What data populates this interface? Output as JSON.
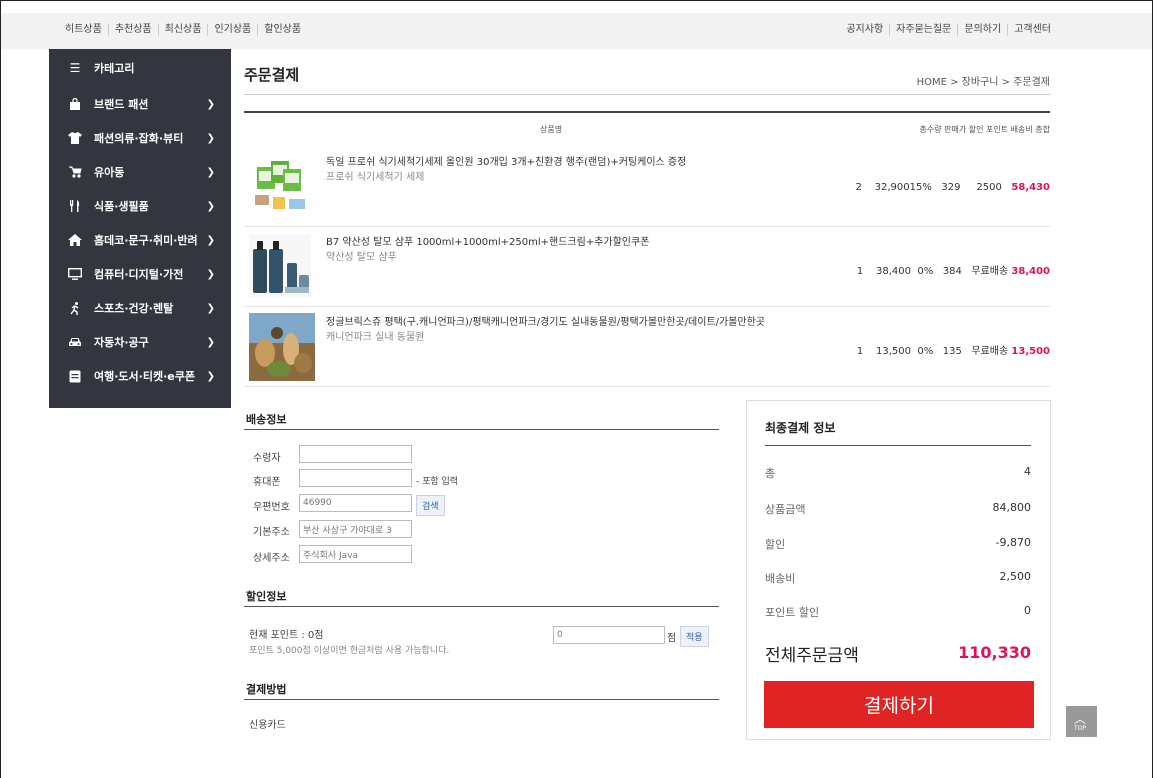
{
  "topnav": {
    "left": [
      "히트상품",
      "추천상품",
      "최신상품",
      "인기상품",
      "할인상품"
    ],
    "right": [
      "공지사항",
      "자주묻는질문",
      "문의하기",
      "고객센터"
    ]
  },
  "sidebar": {
    "header": "카테고리",
    "items": [
      {
        "label": "브랜드 패션",
        "icon": "bag-icon"
      },
      {
        "label": "패션의류·잡화·뷰티",
        "icon": "tshirt-icon"
      },
      {
        "label": "유아동",
        "icon": "stroller-icon"
      },
      {
        "label": "식품·생필품",
        "icon": "cutlery-icon"
      },
      {
        "label": "홈데코·문구·취미·반려",
        "icon": "home-icon"
      },
      {
        "label": "컴퓨터·디지털·가전",
        "icon": "monitor-icon"
      },
      {
        "label": "스포츠·건강·렌탈",
        "icon": "running-icon"
      },
      {
        "label": "자동차·공구",
        "icon": "car-icon"
      },
      {
        "label": "여행·도서·티켓·e쿠폰",
        "icon": "ticket-icon"
      }
    ]
  },
  "page": {
    "title": "주문결제",
    "breadcrumb": "HOME > 장바구니 > 주문결제"
  },
  "table": {
    "col_name": "상품명",
    "col_rest": "총수량 판매가 할인 포인트 배송비 총합"
  },
  "products": [
    {
      "name": "독일 프로쉬 식기세척기세제 올인원 30개입 3개+친환경 행주(랜덤)+커팅케이스 증정",
      "sub": "프로쉬 식기세척기 세제",
      "qty": "2",
      "price": "32,900",
      "discount": "15%",
      "points": "329",
      "shipping": "2500",
      "total": "58,430"
    },
    {
      "name": "B7 약산성 탈모 샴푸 1000ml+1000ml+250ml+핸드크림+추가할인쿠폰",
      "sub": "약산성 탈모 샴푸",
      "qty": "1",
      "price": "38,400",
      "discount": "0%",
      "points": "384",
      "shipping": "무료배송",
      "total": "38,400"
    },
    {
      "name": "정글브릭스쥬 평택(구.캐니언파크)/평택캐니언파크/경기도 실내동물원/평택가볼만한곳/데이트/가볼만한곳",
      "sub": "캐니언파크 실내 동물원",
      "qty": "1",
      "price": "13,500",
      "discount": "0%",
      "points": "135",
      "shipping": "무료배송",
      "total": "13,500"
    }
  ],
  "delivery": {
    "title": "배송정보",
    "recipient_label": "수령자",
    "phone_label": "휴대폰",
    "phone_hint": "- 포함 입력",
    "zip_label": "우편번호",
    "zip_value": "46990",
    "search_btn": "검색",
    "addr1_label": "기본주소",
    "addr1_value": "부산 사상구 가야대로 3",
    "addr2_label": "상세주소",
    "addr2_value": "주식회사 Java"
  },
  "discount": {
    "title": "할인정보",
    "current_points": "현재 포인트 : 0점",
    "note": "포인트 5,000점 이상이면 현금처럼 사용 가능합니다.",
    "input_value": "0",
    "unit": "점",
    "apply_btn": "적용"
  },
  "payment": {
    "title": "결제방법",
    "method": "신용카드"
  },
  "summary": {
    "title": "최종결제 정보",
    "rows": [
      {
        "label": "총",
        "value": "4"
      },
      {
        "label": "상품금액",
        "value": "84,800"
      },
      {
        "label": "할인",
        "value": "-9,870"
      },
      {
        "label": "배송비",
        "value": "2,500"
      },
      {
        "label": "포인트 할인",
        "value": "0"
      }
    ],
    "total_label": "전체주문금액",
    "total_value": "110,330",
    "pay_btn": "결제하기"
  },
  "top_btn": "TOP",
  "colors": {
    "accent": "#e0115f",
    "pay": "#e02424",
    "sidebar": "#33363f"
  }
}
